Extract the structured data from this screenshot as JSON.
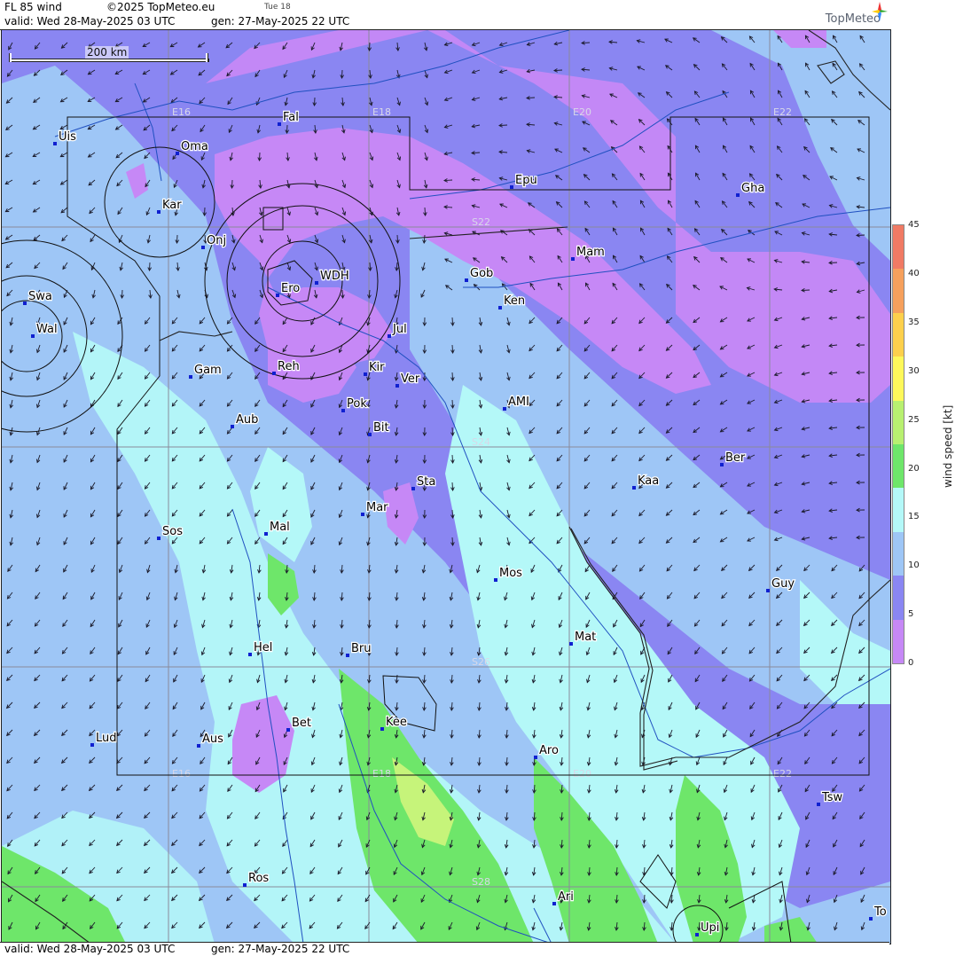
{
  "header": {
    "product": "FL 85 wind",
    "copyright": "©2025 TopMeteo.eu",
    "day_label": "Tue 18",
    "valid": "valid:  Wed  28-May-2025  03 UTC",
    "gen": "gen: 27-May-2025 22 UTC",
    "brand": "TopMeteo"
  },
  "footer": {
    "valid": "valid:  Wed  28-May-2025  03 UTC",
    "gen": "gen: 27-May-2025 22 UTC"
  },
  "scale_bar": {
    "label": "200 km"
  },
  "grid_labels": {
    "lon": [
      "E16",
      "E18",
      "E20",
      "E22"
    ],
    "lat": [
      "S22",
      "S24",
      "S26",
      "S28"
    ]
  },
  "stations": [
    {
      "name": "Uis"
    },
    {
      "name": "Fal"
    },
    {
      "name": "Oma"
    },
    {
      "name": "Epu"
    },
    {
      "name": "Gha"
    },
    {
      "name": "Kar"
    },
    {
      "name": "Onj"
    },
    {
      "name": "Mam"
    },
    {
      "name": "Gob"
    },
    {
      "name": "WDH"
    },
    {
      "name": "Swa"
    },
    {
      "name": "Ero"
    },
    {
      "name": "Ken"
    },
    {
      "name": "Wal"
    },
    {
      "name": "Jul"
    },
    {
      "name": "Gam"
    },
    {
      "name": "Reh"
    },
    {
      "name": "Kir"
    },
    {
      "name": "Ver"
    },
    {
      "name": "AMI"
    },
    {
      "name": "Pok"
    },
    {
      "name": "Aub"
    },
    {
      "name": "Bit"
    },
    {
      "name": "Ber"
    },
    {
      "name": "Sta"
    },
    {
      "name": "Kaa"
    },
    {
      "name": "Mar"
    },
    {
      "name": "Sos"
    },
    {
      "name": "Mal"
    },
    {
      "name": "Mos"
    },
    {
      "name": "Guy"
    },
    {
      "name": "Mat"
    },
    {
      "name": "Hel"
    },
    {
      "name": "Bru"
    },
    {
      "name": "Bet"
    },
    {
      "name": "Kee"
    },
    {
      "name": "Lud"
    },
    {
      "name": "Aus"
    },
    {
      "name": "Aro"
    },
    {
      "name": "Tsw"
    },
    {
      "name": "Ros"
    },
    {
      "name": "Ari"
    },
    {
      "name": "To"
    },
    {
      "name": "Upi"
    }
  ],
  "legend": {
    "title": "wind speed [kt]",
    "ticks": [
      "45",
      "40",
      "35",
      "30",
      "25",
      "20",
      "15",
      "10",
      "5",
      "0"
    ],
    "colors": [
      "#f07a64",
      "#f6a05c",
      "#fdd04c",
      "#fef85a",
      "#b8f070",
      "#6ee66a",
      "#b4f8f8",
      "#9ec6f6",
      "#8a86f2",
      "#c688f6"
    ]
  },
  "colors": {
    "violet": "#c688f6",
    "blue_violet": "#8a86f2",
    "light_blue": "#9ec6f6",
    "cyan": "#b4f8f8",
    "green": "#6ee66a",
    "yellow_green": "#c6f47a"
  }
}
